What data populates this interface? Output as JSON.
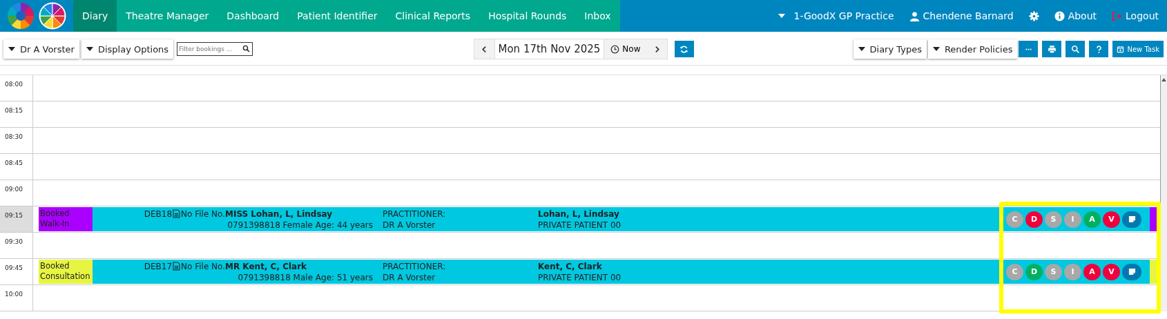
{
  "nav": {
    "tabs": [
      {
        "label": "Diary",
        "selected": true
      },
      {
        "label": "Theatre Manager",
        "selected": false
      },
      {
        "label": "Dashboard",
        "selected": false
      },
      {
        "label": "Patient Identifier",
        "selected": false
      },
      {
        "label": "Clinical Reports",
        "selected": false
      },
      {
        "label": "Hospital Rounds",
        "selected": false
      },
      {
        "label": "Inbox",
        "selected": false
      }
    ],
    "practice": "1-GoodX GP Practice",
    "user": "Chendene Barnard",
    "about": "About",
    "logout": "Logout"
  },
  "toolbar": {
    "doctor": "Dr A Vorster",
    "display_options": "Display Options",
    "filter": {
      "placeholder": "Filter bookings ..."
    },
    "date": "Mon 17th Nov 2025",
    "now": "Now",
    "diary_types": "Diary Types",
    "render_policies": "Render Policies",
    "new_task": "New Task"
  },
  "diary": {
    "slots": [
      {
        "time": "08:00",
        "highlighted": false
      },
      {
        "time": "08:15",
        "highlighted": false
      },
      {
        "time": "08:30",
        "highlighted": false
      },
      {
        "time": "08:45",
        "highlighted": false
      },
      {
        "time": "09:00",
        "highlighted": false
      },
      {
        "time": "09:15",
        "highlighted": true,
        "booking": {
          "status": "Booked Walk-In",
          "color": "#aa00ff",
          "code": "DEB18",
          "file": "No File No.",
          "patient": "MISS Lohan, L, Lindsay",
          "details": "0791398818 Female Age: 44 years",
          "practitioner_label": "PRACTITIONER:",
          "practitioner": "DR A Vorster",
          "account": "Lohan, L, Lindsay",
          "plan": "PRIVATE PATIENT 00",
          "badges": [
            {
              "letter": "C",
              "color": "#a8a8a8"
            },
            {
              "letter": "D",
              "color": "#f0003c"
            },
            {
              "letter": "S",
              "color": "#a8a8a8"
            },
            {
              "letter": "I",
              "color": "#a8a8a8"
            },
            {
              "letter": "A",
              "color": "#00b060"
            },
            {
              "letter": "V",
              "color": "#f0003c"
            }
          ]
        }
      },
      {
        "time": "09:30",
        "highlighted": false
      },
      {
        "time": "09:45",
        "highlighted": false,
        "booking": {
          "status": "Booked Consultation",
          "color": "#e6f542",
          "code": "DEB17",
          "file": "No File No.",
          "patient": "MR Kent, C, Clark",
          "details": "0791398818 Male Age: 51 years",
          "practitioner_label": "PRACTITIONER:",
          "practitioner": "DR A Vorster",
          "account": "Kent, C, Clark",
          "plan": "PRIVATE PATIENT 00",
          "badges": [
            {
              "letter": "C",
              "color": "#a8a8a8"
            },
            {
              "letter": "D",
              "color": "#00b060"
            },
            {
              "letter": "S",
              "color": "#a8a8a8"
            },
            {
              "letter": "I",
              "color": "#a8a8a8"
            },
            {
              "letter": "A",
              "color": "#f0003c"
            },
            {
              "letter": "V",
              "color": "#f0003c"
            }
          ]
        }
      },
      {
        "time": "10:00",
        "highlighted": false
      }
    ]
  }
}
